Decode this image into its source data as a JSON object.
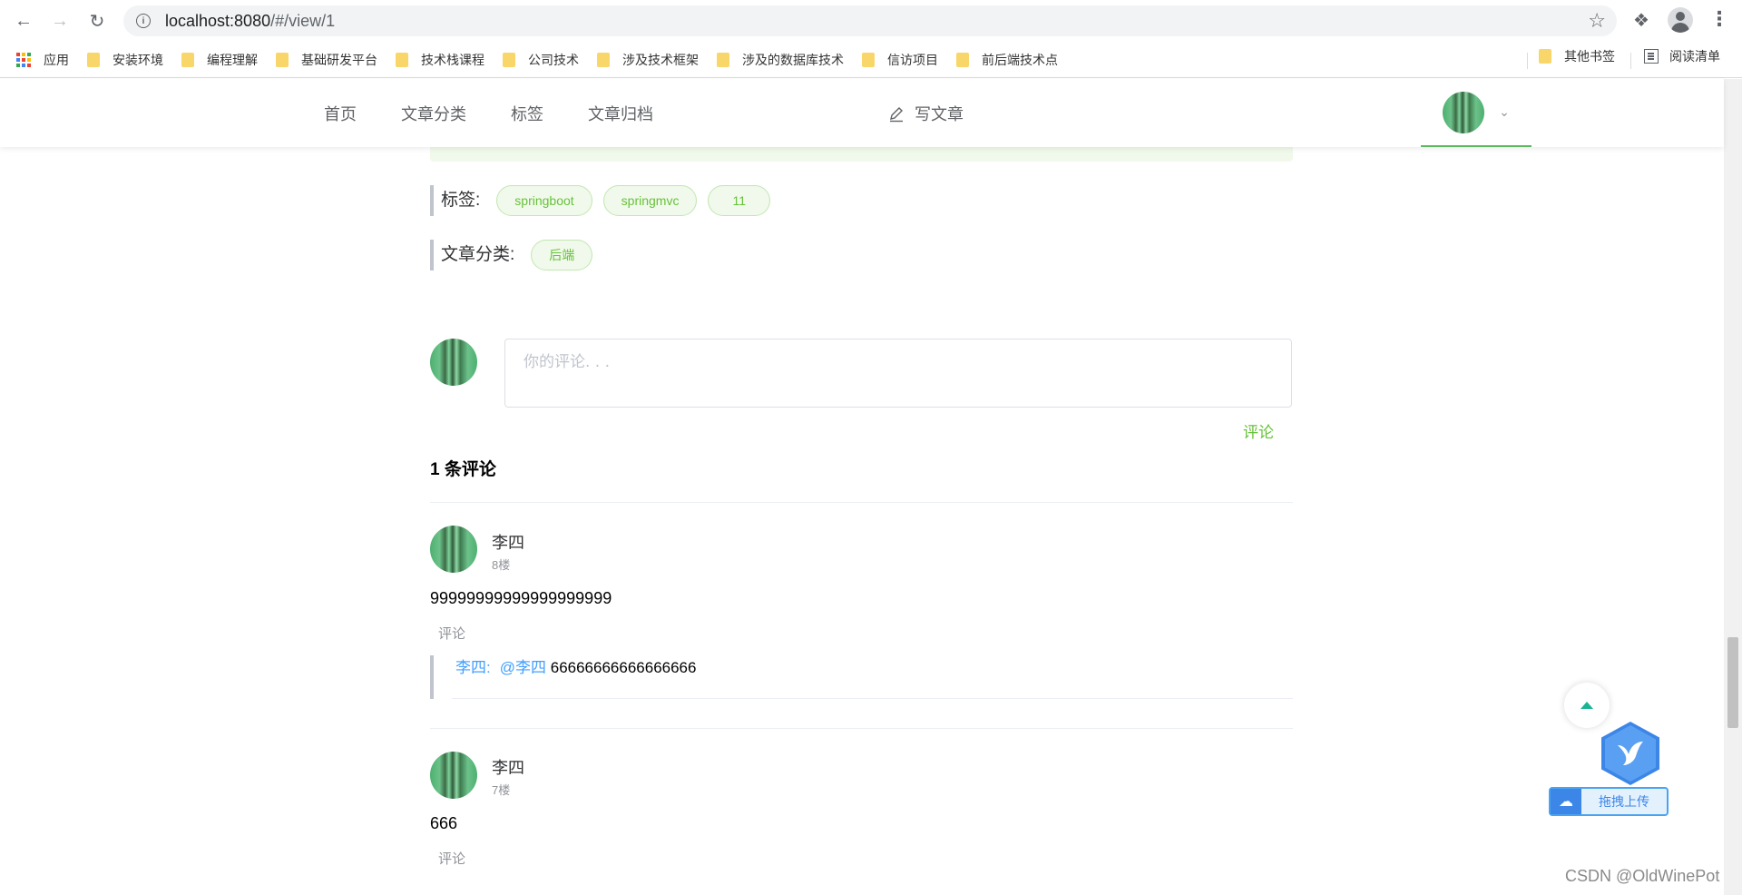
{
  "browser": {
    "url_host": "localhost:8080",
    "url_path": "/#/view/1",
    "bookmarks": [
      {
        "label": "应用",
        "type": "apps"
      },
      {
        "label": "安装环境",
        "type": "folder"
      },
      {
        "label": "编程理解",
        "type": "folder"
      },
      {
        "label": "基础研发平台",
        "type": "folder"
      },
      {
        "label": "技术栈课程",
        "type": "folder"
      },
      {
        "label": "公司技术",
        "type": "folder"
      },
      {
        "label": "涉及技术框架",
        "type": "folder"
      },
      {
        "label": "涉及的数据库技术",
        "type": "folder"
      },
      {
        "label": "信访项目",
        "type": "folder"
      },
      {
        "label": "前后端技术点",
        "type": "folder"
      }
    ],
    "other_bookmarks": "其他书签",
    "reading_list": "阅读清单"
  },
  "header": {
    "nav": [
      "首页",
      "文章分类",
      "标签",
      "文章归档"
    ],
    "write": "写文章"
  },
  "article": {
    "tags_label": "标签:",
    "tags": [
      "springboot",
      "springmvc",
      "11"
    ],
    "category_label": "文章分类:",
    "category": "后端"
  },
  "comment_form": {
    "placeholder": "你的评论. . .",
    "submit": "评论"
  },
  "comments_count_title": "1 条评论",
  "comments": [
    {
      "author": "李四",
      "floor": "8楼",
      "content": "99999999999999999999",
      "reply_action": "评论",
      "replies": [
        {
          "author": "李四:",
          "mention": "@李四",
          "content": "66666666666666666"
        }
      ]
    },
    {
      "author": "李四",
      "floor": "7楼",
      "content": "666",
      "reply_action": "评论"
    }
  ],
  "upload_widget": {
    "label": "拖拽上传"
  },
  "watermark": "CSDN @OldWinePot",
  "colors": {
    "accent_green": "#67c23a",
    "link_blue": "#409eff",
    "tag_bg": "#f0f9eb"
  }
}
